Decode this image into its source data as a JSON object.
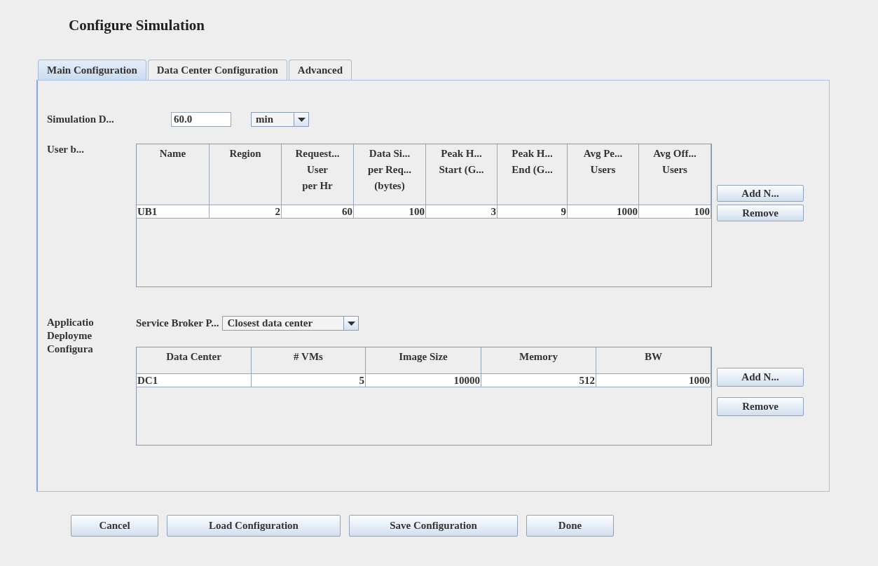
{
  "title": "Configure Simulation",
  "tabs": [
    {
      "label": "Main Configuration",
      "selected": true
    },
    {
      "label": "Data Center Configuration",
      "selected": false
    },
    {
      "label": "Advanced",
      "selected": false
    }
  ],
  "simulation_duration": {
    "label": "Simulation D...",
    "value": "60.0",
    "unit": "min"
  },
  "user_bases": {
    "label": "User b...",
    "columns": [
      "Name",
      "Region",
      "Request...\nUser\nper Hr",
      "Data Si...\nper Req...\n(bytes)",
      "Peak H...\nStart (G...",
      "Peak H...\nEnd (G...",
      "Avg Pe...\nUsers",
      "Avg Off...\nUsers"
    ],
    "rows": [
      [
        "UB1",
        "2",
        "60",
        "100",
        "3",
        "9",
        "1000",
        "100"
      ]
    ],
    "buttons": [
      "Add N...",
      "Remove"
    ]
  },
  "app_deployment": {
    "label_lines": [
      "Applicatio",
      "Deployme",
      "Configura"
    ],
    "broker_label": "Service Broker P...",
    "broker_value": "Closest data center",
    "columns": [
      "Data Center",
      "# VMs",
      "Image Size",
      "Memory",
      "BW"
    ],
    "rows": [
      [
        "DC1",
        "5",
        "10000",
        "512",
        "1000"
      ]
    ],
    "buttons": [
      "Add N...",
      "Remove"
    ]
  },
  "footer_buttons": [
    "Cancel",
    "Load Configuration",
    "Save Configuration",
    "Done"
  ]
}
